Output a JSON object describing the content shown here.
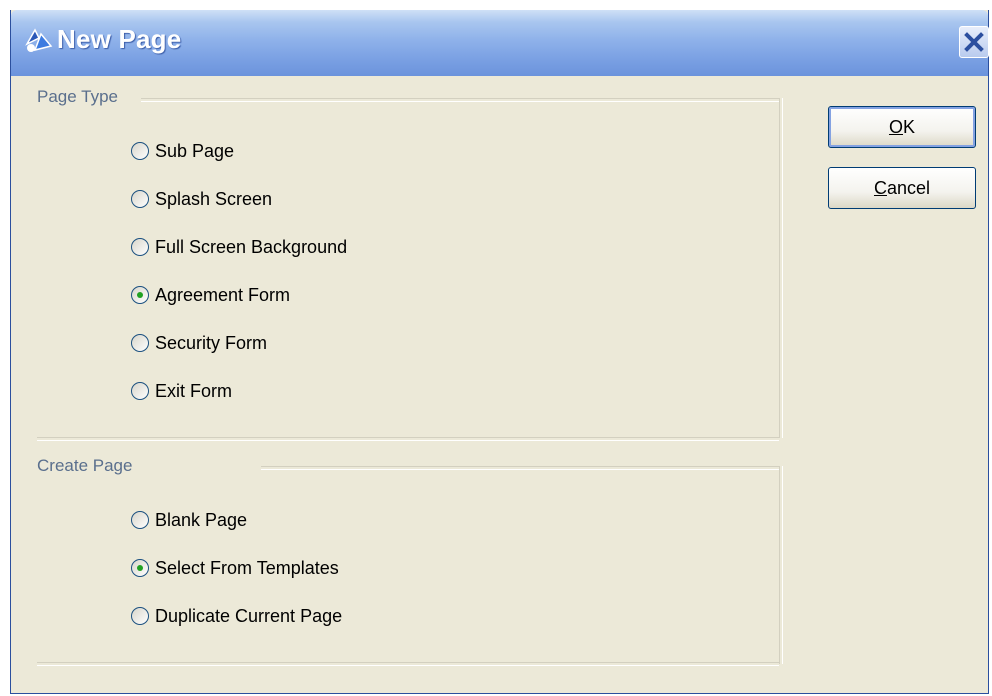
{
  "window": {
    "title": "New Page"
  },
  "page_type": {
    "label": "Page Type",
    "options": [
      {
        "label": "Sub Page",
        "selected": false
      },
      {
        "label": "Splash Screen",
        "selected": false
      },
      {
        "label": "Full Screen Background",
        "selected": false
      },
      {
        "label": "Agreement Form",
        "selected": true
      },
      {
        "label": "Security Form",
        "selected": false
      },
      {
        "label": "Exit Form",
        "selected": false
      }
    ]
  },
  "create_page": {
    "label": "Create Page",
    "options": [
      {
        "label": "Blank Page",
        "selected": false
      },
      {
        "label": "Select From Templates",
        "selected": true
      },
      {
        "label": "Duplicate Current Page",
        "selected": false
      }
    ]
  },
  "buttons": {
    "ok": {
      "mnemonic": "O",
      "rest": "K"
    },
    "cancel": {
      "mnemonic": "C",
      "rest": "ancel"
    }
  },
  "colors": {
    "title_gradient_start": "#cfe0f6",
    "title_gradient_end": "#6b93dc",
    "dialog_bg": "#ece9d8",
    "selected_dot": "#21a121"
  }
}
